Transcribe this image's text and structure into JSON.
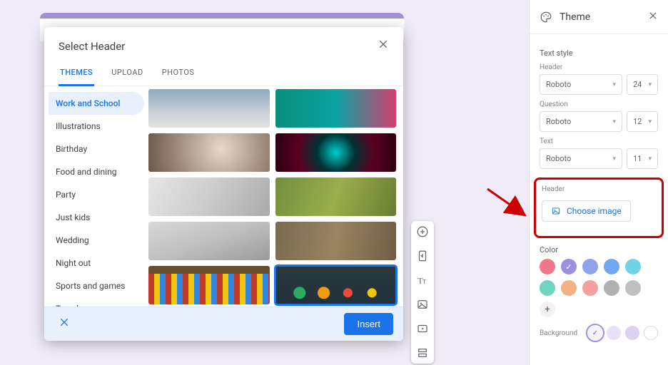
{
  "modal": {
    "title": "Select Header",
    "tabs": [
      {
        "label": "THEMES",
        "active": true
      },
      {
        "label": "UPLOAD",
        "active": false
      },
      {
        "label": "PHOTOS",
        "active": false
      }
    ],
    "categories": [
      {
        "label": "Work and School",
        "active": true
      },
      {
        "label": "Illustrations"
      },
      {
        "label": "Birthday"
      },
      {
        "label": "Food and dining"
      },
      {
        "label": "Party"
      },
      {
        "label": "Just kids"
      },
      {
        "label": "Wedding"
      },
      {
        "label": "Night out"
      },
      {
        "label": "Sports and games"
      },
      {
        "label": "Travel"
      }
    ],
    "selected_index": 9,
    "footer": {
      "insert": "Insert"
    }
  },
  "theme_panel": {
    "title": "Theme",
    "text_style_label": "Text style",
    "header_label": "Header",
    "question_label": "Question",
    "text_label": "Text",
    "fonts": {
      "header": {
        "family": "Roboto",
        "size": "24"
      },
      "question": {
        "family": "Roboto",
        "size": "12"
      },
      "text": {
        "family": "Roboto",
        "size": "11"
      }
    },
    "header_section_label": "Header",
    "choose_image_label": "Choose image",
    "color_label": "Color",
    "colors": [
      {
        "hex": "#ef798a"
      },
      {
        "hex": "#9e8fe0",
        "selected": true
      },
      {
        "hex": "#8fa4e8"
      },
      {
        "hex": "#6fa8ef"
      },
      {
        "hex": "#6fd4e8"
      },
      {
        "hex": "#6fd4c0"
      },
      {
        "hex": "#f4b183"
      },
      {
        "hex": "#f4a0a0"
      },
      {
        "hex": "#b0b0b0"
      },
      {
        "hex": "#c0c0c0"
      }
    ],
    "background_label": "Background",
    "background_colors": [
      {
        "hex": "#f6f2fb",
        "selected": true
      },
      {
        "hex": "#e9e1f7"
      },
      {
        "hex": "#ddd1f2"
      },
      {
        "hex": "#ffffff"
      }
    ]
  }
}
